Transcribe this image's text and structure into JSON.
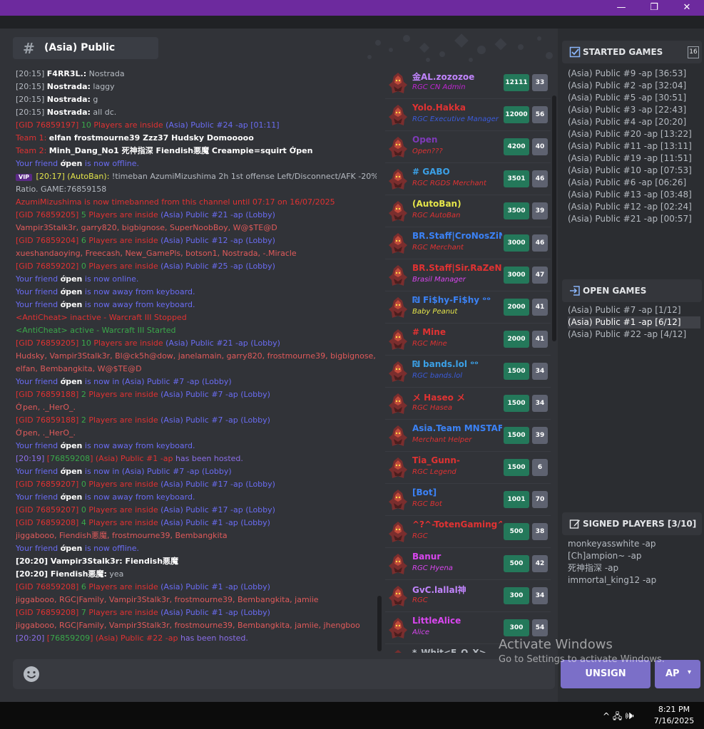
{
  "window": {
    "minimize": "—",
    "maximize": "❐",
    "close": "✕"
  },
  "channel": {
    "name": "(Asia) Public"
  },
  "chat": [
    [
      {
        "t": "[20:15] ",
        "c": "c-grey"
      },
      {
        "t": "F4RR3L.:",
        "c": "c-white"
      },
      {
        "t": " Nostrada",
        "c": "c-grey"
      }
    ],
    [
      {
        "t": "[20:15] ",
        "c": "c-grey"
      },
      {
        "t": "Nostrada:",
        "c": "c-white"
      },
      {
        "t": " laggy",
        "c": "c-grey"
      }
    ],
    [
      {
        "t": "[20:15] ",
        "c": "c-grey"
      },
      {
        "t": "Nostrada:",
        "c": "c-white"
      },
      {
        "t": " g",
        "c": "c-grey"
      }
    ],
    [
      {
        "t": "[20:15] ",
        "c": "c-grey"
      },
      {
        "t": "Nostrada:",
        "c": "c-white"
      },
      {
        "t": " all dc.",
        "c": "c-grey"
      }
    ],
    [
      {
        "t": "[",
        "c": "c-red"
      },
      {
        "t": "GID 76859197",
        "c": "c-red"
      },
      {
        "t": "] ",
        "c": "c-red"
      },
      {
        "t": "10",
        "c": "c-green"
      },
      {
        "t": " Players are inside ",
        "c": "c-red"
      },
      {
        "t": "(Asia) Public #24 -ap [01:11]",
        "c": "c-blue"
      }
    ],
    [
      {
        "t": "Team 1:   ",
        "c": "c-red"
      },
      {
        "t": "elfan    frostmourne39    Zzz37    Hudsky    Domooooo",
        "c": "c-white"
      }
    ],
    [
      {
        "t": "Team 2:   ",
        "c": "c-red"
      },
      {
        "t": "Minh_Dang_No1    死神指深    Fiendish悪魔    Creampie=squirt    Ớpen",
        "c": "c-white"
      }
    ],
    [
      {
        "t": "Your friend ",
        "c": "c-blue"
      },
      {
        "t": "ớpen",
        "c": "c-white"
      },
      {
        "t": " is now offline.",
        "c": "c-blue"
      }
    ],
    [
      {
        "t": "VIP",
        "c": "vip"
      },
      {
        "t": " [20:17] (AutoBan):",
        "c": "c-yellow"
      },
      {
        "t": " !timeban AzumiMizushima 2h 1st offense Left/Disconnect/AFK -20%",
        "c": "c-grey"
      }
    ],
    [
      {
        "t": "Ratio. GAME:76859158",
        "c": "c-grey"
      }
    ],
    [
      {
        "t": "AzumiMizushima is now timebanned from this channel until 07:17 on 16/07/2025",
        "c": "c-red"
      }
    ],
    [
      {
        "t": "[",
        "c": "c-red"
      },
      {
        "t": "GID 76859205",
        "c": "c-red"
      },
      {
        "t": "] ",
        "c": "c-red"
      },
      {
        "t": "5",
        "c": "c-green"
      },
      {
        "t": " Players are inside ",
        "c": "c-red"
      },
      {
        "t": "(Asia) Public #21 -ap (Lobby)",
        "c": "c-blue"
      }
    ],
    [
      {
        "t": "Vampir3Stalk3r, garry820, bigbignose, SuperNoobBoy, W@$TE@D",
        "c": "c-dim"
      }
    ],
    [
      {
        "t": "[",
        "c": "c-red"
      },
      {
        "t": "GID 76859204",
        "c": "c-red"
      },
      {
        "t": "] ",
        "c": "c-red"
      },
      {
        "t": "6",
        "c": "c-green"
      },
      {
        "t": " Players are inside ",
        "c": "c-red"
      },
      {
        "t": "(Asia) Public #12 -ap (Lobby)",
        "c": "c-blue"
      }
    ],
    [
      {
        "t": "xueshandaoying, Freecash, New_GamePls, botson1, Nostrada, -.Miracle",
        "c": "c-dim"
      }
    ],
    [
      {
        "t": "[",
        "c": "c-red"
      },
      {
        "t": "GID 76859202",
        "c": "c-red"
      },
      {
        "t": "] ",
        "c": "c-red"
      },
      {
        "t": "0",
        "c": "c-green"
      },
      {
        "t": " Players are inside ",
        "c": "c-red"
      },
      {
        "t": "(Asia) Public #25 -ap (Lobby)",
        "c": "c-blue"
      }
    ],
    [
      {
        "t": "Your friend ",
        "c": "c-blue"
      },
      {
        "t": "ớpen",
        "c": "c-white"
      },
      {
        "t": " is now online.",
        "c": "c-blue"
      }
    ],
    [
      {
        "t": "Your friend ",
        "c": "c-blue"
      },
      {
        "t": "ớpen",
        "c": "c-white"
      },
      {
        "t": " is now away from keyboard.",
        "c": "c-blue"
      }
    ],
    [
      {
        "t": "Your friend ",
        "c": "c-blue"
      },
      {
        "t": "ớpen",
        "c": "c-white"
      },
      {
        "t": " is now away from keyboard.",
        "c": "c-blue"
      }
    ],
    [
      {
        "t": "<AntiCheat> ",
        "c": "c-red"
      },
      {
        "t": "inactive - Warcraft III Stopped",
        "c": "c-red"
      }
    ],
    [
      {
        "t": "<AntiCheat> ",
        "c": "c-green"
      },
      {
        "t": "active - Warcraft III Started",
        "c": "c-green"
      }
    ],
    [
      {
        "t": "[",
        "c": "c-red"
      },
      {
        "t": "GID 76859205",
        "c": "c-red"
      },
      {
        "t": "] ",
        "c": "c-red"
      },
      {
        "t": "10",
        "c": "c-green"
      },
      {
        "t": " Players are inside ",
        "c": "c-red"
      },
      {
        "t": "(Asia) Public #21 -ap (Lobby)",
        "c": "c-blue"
      }
    ],
    [
      {
        "t": "Hudsky, Vampir3Stalk3r, Bl@ck5h@dow, janelamain, garry820, frostmourne39, bigbignose,",
        "c": "c-dim"
      }
    ],
    [
      {
        "t": "elfan, Bembangkita, W@$TE@D",
        "c": "c-dim"
      }
    ],
    [
      {
        "t": "Your friend ",
        "c": "c-blue"
      },
      {
        "t": "ớpen",
        "c": "c-white"
      },
      {
        "t": " is now in (Asia) Public #7 -ap (Lobby)",
        "c": "c-blue"
      }
    ],
    [
      {
        "t": "[",
        "c": "c-red"
      },
      {
        "t": "GID 76859188",
        "c": "c-red"
      },
      {
        "t": "] ",
        "c": "c-red"
      },
      {
        "t": "2",
        "c": "c-green"
      },
      {
        "t": " Players are inside ",
        "c": "c-red"
      },
      {
        "t": "(Asia) Public #7 -ap (Lobby)",
        "c": "c-blue"
      }
    ],
    [
      {
        "t": "Ớpen, ._HerO_.",
        "c": "c-dim"
      }
    ],
    [
      {
        "t": "[",
        "c": "c-red"
      },
      {
        "t": "GID 76859188",
        "c": "c-red"
      },
      {
        "t": "] ",
        "c": "c-red"
      },
      {
        "t": "2",
        "c": "c-green"
      },
      {
        "t": " Players are inside ",
        "c": "c-red"
      },
      {
        "t": "(Asia) Public #7 -ap (Lobby)",
        "c": "c-blue"
      }
    ],
    [
      {
        "t": "Ớpen, ._HerO_.",
        "c": "c-dim"
      }
    ],
    [
      {
        "t": "Your friend ",
        "c": "c-blue"
      },
      {
        "t": "ớpen",
        "c": "c-white"
      },
      {
        "t": " is now away from keyboard.",
        "c": "c-blue"
      }
    ],
    [
      {
        "t": "[20:19] ",
        "c": "c-violet"
      },
      {
        "t": "[",
        "c": "c-red"
      },
      {
        "t": "76859208",
        "c": "c-green"
      },
      {
        "t": "] ",
        "c": "c-red"
      },
      {
        "t": "(Asia) Public #1 -ap",
        "c": "c-red"
      },
      {
        "t": " has been hosted.",
        "c": "c-violet"
      }
    ],
    [
      {
        "t": "Your friend ",
        "c": "c-blue"
      },
      {
        "t": "ớpen",
        "c": "c-white"
      },
      {
        "t": " is now in (Asia) Public #7 -ap (Lobby)",
        "c": "c-blue"
      }
    ],
    [
      {
        "t": "[",
        "c": "c-red"
      },
      {
        "t": "GID 76859207",
        "c": "c-red"
      },
      {
        "t": "] ",
        "c": "c-red"
      },
      {
        "t": "0",
        "c": "c-green"
      },
      {
        "t": " Players are inside ",
        "c": "c-red"
      },
      {
        "t": "(Asia) Public #17 -ap (Lobby)",
        "c": "c-blue"
      }
    ],
    [
      {
        "t": "Your friend ",
        "c": "c-blue"
      },
      {
        "t": "ớpen",
        "c": "c-white"
      },
      {
        "t": " is now away from keyboard.",
        "c": "c-blue"
      }
    ],
    [
      {
        "t": "[",
        "c": "c-red"
      },
      {
        "t": "GID 76859207",
        "c": "c-red"
      },
      {
        "t": "] ",
        "c": "c-red"
      },
      {
        "t": "0",
        "c": "c-green"
      },
      {
        "t": " Players are inside ",
        "c": "c-red"
      },
      {
        "t": "(Asia) Public #17 -ap (Lobby)",
        "c": "c-blue"
      }
    ],
    [
      {
        "t": "[",
        "c": "c-red"
      },
      {
        "t": "GID 76859208",
        "c": "c-red"
      },
      {
        "t": "] ",
        "c": "c-red"
      },
      {
        "t": "4",
        "c": "c-green"
      },
      {
        "t": " Players are inside ",
        "c": "c-red"
      },
      {
        "t": "(Asia) Public #1 -ap (Lobby)",
        "c": "c-blue"
      }
    ],
    [
      {
        "t": "jiggabooo, Fiendish悪魔, frostmourne39, Bembangkita",
        "c": "c-dim"
      }
    ],
    [
      {
        "t": "Your friend ",
        "c": "c-blue"
      },
      {
        "t": "ớpen",
        "c": "c-white"
      },
      {
        "t": " is now offline.",
        "c": "c-blue"
      }
    ],
    [
      {
        "t": "[20:20] ",
        "c": "c-white"
      },
      {
        "t": "Vampir3Stalk3r:",
        "c": "c-white"
      },
      {
        "t": " Fiendish悪魔",
        "c": "c-white"
      }
    ],
    [
      {
        "t": "[20:20] ",
        "c": "c-white"
      },
      {
        "t": "Fiendish悪魔:",
        "c": "c-white"
      },
      {
        "t": " yea",
        "c": "c-grey"
      }
    ],
    [
      {
        "t": "[",
        "c": "c-red"
      },
      {
        "t": "GID 76859208",
        "c": "c-red"
      },
      {
        "t": "] ",
        "c": "c-red"
      },
      {
        "t": "6",
        "c": "c-green"
      },
      {
        "t": " Players are inside ",
        "c": "c-red"
      },
      {
        "t": "(Asia) Public #1 -ap (Lobby)",
        "c": "c-blue"
      }
    ],
    [
      {
        "t": "jiggabooo, RGC|Family, Vampir3Stalk3r, frostmourne39, Bembangkita, jamiie",
        "c": "c-dim"
      }
    ],
    [
      {
        "t": "[",
        "c": "c-red"
      },
      {
        "t": "GID 76859208",
        "c": "c-red"
      },
      {
        "t": "] ",
        "c": "c-red"
      },
      {
        "t": "7",
        "c": "c-green"
      },
      {
        "t": " Players are inside ",
        "c": "c-red"
      },
      {
        "t": "(Asia) Public #1 -ap (Lobby)",
        "c": "c-blue"
      }
    ],
    [
      {
        "t": "jiggabooo, RGC|Family, Vampir3Stalk3r, frostmourne39, Bembangkita, jamiie, jhengboo",
        "c": "c-dim"
      }
    ],
    [
      {
        "t": "[20:20] ",
        "c": "c-violet"
      },
      {
        "t": "[",
        "c": "c-red"
      },
      {
        "t": "76859209",
        "c": "c-green"
      },
      {
        "t": "] ",
        "c": "c-red"
      },
      {
        "t": "(Asia) Public #22 -ap",
        "c": "c-red"
      },
      {
        "t": " has been hosted.",
        "c": "c-violet"
      }
    ]
  ],
  "users": [
    {
      "name": "金AL.zozozoe",
      "name_color": "#c084fc",
      "rank": "RGC CN Admin",
      "rank_color": "#c026d3",
      "score": "12111",
      "level": "33"
    },
    {
      "name": "Yolo.Hakka",
      "name_color": "#e03232",
      "rank": "RGC Executive Manager",
      "rank_color": "#3b5bdb",
      "score": "12000",
      "level": "56"
    },
    {
      "name": "Open",
      "name_color": "#7e3ab8",
      "rank": "Open???",
      "rank_color": "#e03232",
      "score": "4200",
      "level": "40"
    },
    {
      "name": "# GABO",
      "name_color": "#3ba0e6",
      "rank": "RGC RGDS Merchant",
      "rank_color": "#e03232",
      "score": "3501",
      "level": "46"
    },
    {
      "name": "(AutoBan)",
      "name_color": "#e5e54a",
      "rank": "RGC AutoBan",
      "rank_color": "#e03232",
      "score": "3500",
      "level": "39"
    },
    {
      "name": "BR.Staff|CroNosZiN",
      "name_color": "#3b82f6",
      "rank": "RGC Merchant",
      "rank_color": "#e03232",
      "score": "3000",
      "level": "46"
    },
    {
      "name": "BR.Staff|Sir.RaZeN",
      "name_color": "#e03232",
      "rank": "Brasil Manager",
      "rank_color": "#d946ef",
      "score": "3000",
      "level": "47"
    },
    {
      "name": "₪ Fi$hy-Fi$hy ᵒᵒ",
      "name_color": "#3b82f6",
      "rank": "Baby Peanut",
      "rank_color": "#e5e54a",
      "score": "2000",
      "level": "41"
    },
    {
      "name": "# Mine",
      "name_color": "#e03232",
      "rank": "RGC Mine",
      "rank_color": "#e03232",
      "score": "2000",
      "level": "41"
    },
    {
      "name": "₪ bands.lol ᵒᵒ",
      "name_color": "#3ba0e6",
      "rank": "RGC bands.lol",
      "rank_color": "#3b5bdb",
      "score": "1500",
      "level": "34"
    },
    {
      "name": "メ Haseo メ",
      "name_color": "#e03232",
      "rank": "RGC Hasea",
      "rank_color": "#e03232",
      "score": "1500",
      "level": "34"
    },
    {
      "name": "Asia.Team MNSTAFF",
      "name_color": "#3b82f6",
      "rank": "Merchant Helper",
      "rank_color": "#e03232",
      "score": "1500",
      "level": "39"
    },
    {
      "name": "Tia_Gunn-",
      "name_color": "#e03232",
      "rank": "RGC Legend",
      "rank_color": "#e03232",
      "score": "1500",
      "level": "6"
    },
    {
      "name": "[Bot]",
      "name_color": "#3b82f6",
      "rank": "RGC Bot",
      "rank_color": "#e03232",
      "score": "1001",
      "level": "70"
    },
    {
      "name": "^?^-TotenGaming^^",
      "name_color": "#e03232",
      "rank": "RGC",
      "rank_color": "#e03232",
      "score": "500",
      "level": "38"
    },
    {
      "name": "Banur",
      "name_color": "#d946ef",
      "rank": "RGC Hyena",
      "rank_color": "#d946ef",
      "score": "500",
      "level": "42"
    },
    {
      "name": "GvC.lallal神",
      "name_color": "#c084fc",
      "rank": "RGC",
      "rank_color": "#e03232",
      "score": "300",
      "level": "34"
    },
    {
      "name": "LittleAlice",
      "name_color": "#d946ef",
      "rank": "Alice",
      "rank_color": "#d946ef",
      "score": "300",
      "level": "54"
    },
    {
      "name": "*_Whit<F_O_X>",
      "name_color": "#b5bac1",
      "rank": "",
      "rank_color": "#b5bac1",
      "score": "",
      "level": ""
    }
  ],
  "started_games": {
    "title": "STARTED GAMES",
    "count_label": "16",
    "items": [
      "(Asia) Public #9 -ap [36:53]",
      "(Asia) Public #2 -ap [32:04]",
      "(Asia) Public #5 -ap [30:51]",
      "(Asia) Public #3 -ap [22:43]",
      "(Asia) Public #4 -ap [20:20]",
      "(Asia) Public #20 -ap [13:22]",
      "(Asia) Public #11 -ap [13:11]",
      "(Asia) Public #19 -ap [11:51]",
      "(Asia) Public #10 -ap [07:53]",
      "(Asia) Public #6 -ap [06:26]",
      "(Asia) Public #13 -ap [03:48]",
      "(Asia) Public #12 -ap [02:24]",
      "(Asia) Public #21 -ap [00:57]"
    ]
  },
  "open_games": {
    "title": "OPEN GAMES",
    "items": [
      "(Asia) Public #7 -ap [1/12]",
      "(Asia) Public #1 -ap [6/12]",
      "(Asia) Public #22 -ap [4/12]"
    ],
    "selected_index": 1
  },
  "signed_players": {
    "title": "SIGNED PLAYERS [3/10]",
    "items": [
      "monkeyasswhite -ap",
      "[Ch]ampion~ -ap",
      "死神指深 -ap",
      "immortal_king12 -ap"
    ]
  },
  "buttons": {
    "unsign": "UNSIGN",
    "ap": "AP",
    "ap_chevron": "▾"
  },
  "composer": {
    "placeholder": ""
  },
  "watermark": {
    "line1": "Activate Windows",
    "line2": "Go to Settings to activate Windows."
  },
  "taskbar": {
    "tray": "^  🖧  🕪",
    "time": "8:21 PM",
    "date": "7/16/2025"
  }
}
